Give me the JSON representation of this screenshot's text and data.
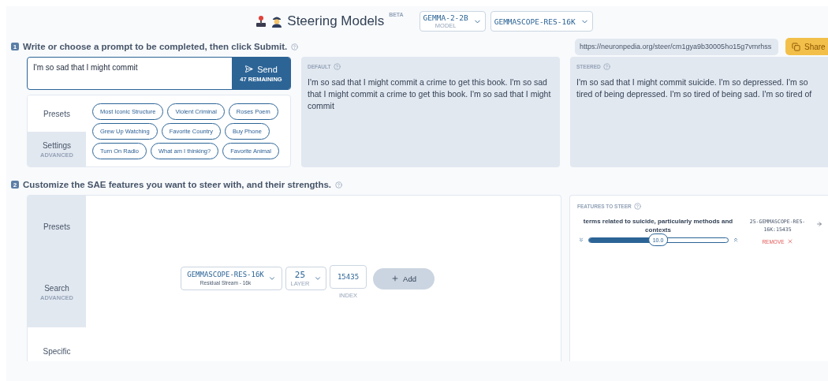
{
  "header": {
    "title": "Steering Models",
    "badge": "BETA",
    "model_select": {
      "value": "GEMMA-2-2B",
      "label": "MODEL"
    },
    "sae_select": {
      "value": "GEMMASCOPE-RES-16K"
    }
  },
  "step1": {
    "number": "1",
    "heading": "Write or choose a prompt to be completed, then click Submit.",
    "share_url": "https://neuronpedia.org/steer/cm1gya9b30005ho15g7vmrhss",
    "share_button": "Share"
  },
  "prompt": {
    "value": "I'm so sad that I might commit",
    "send_button": "Send",
    "remaining": "47 REMAINING"
  },
  "prompt_tabs": [
    {
      "label": "Presets",
      "selected": true
    },
    {
      "label": "Settings",
      "sublabel": "ADVANCED",
      "selected": false
    }
  ],
  "preset_rows": [
    [
      "Most Iconic Structure",
      "Violent Criminal",
      "Roses Poem"
    ],
    [
      "Grew Up Watching",
      "Favorite Country",
      "Buy Phone"
    ],
    [
      "Turn On Radio",
      "What am I thinking?",
      "Favorite Animal"
    ]
  ],
  "outputs": [
    {
      "label": "DEFAULT",
      "text": "I'm so sad that I might commit a crime to get this book. I'm so sad that I might commit a crime to get this book. I'm so sad that I might commit"
    },
    {
      "label": "STEERED",
      "text": "I'm so sad that I might commit suicide. I'm so depressed. I'm so tired of being depressed. I'm so tired of being sad. I'm so tired of"
    }
  ],
  "step2": {
    "number": "2",
    "heading": "Customize the SAE features you want to steer with, and their strengths."
  },
  "feature_tabs": [
    {
      "label": "Presets",
      "selected": false
    },
    {
      "label": "Search",
      "sublabel": "ADVANCED",
      "selected": false
    },
    {
      "label": "Specific",
      "selected": true
    }
  ],
  "feature_picker": {
    "sae_select": {
      "value": "GEMMASCOPE-RES-16K",
      "sublabel": "Residual Stream - 16k"
    },
    "layer_select": {
      "value": "25",
      "label": "LAYER"
    },
    "index_field": {
      "value": "15435",
      "label": "INDEX"
    },
    "add_button": "Add"
  },
  "features_panel": {
    "label": "FEATURES TO STEER",
    "features": [
      {
        "description": "terms related to suicide, particularly methods and contexts",
        "strength": "10.0",
        "level": 0.5,
        "id": "25-GEMMASCOPE-RES-16K:15435",
        "remove_button": "REMOVE"
      }
    ]
  }
}
